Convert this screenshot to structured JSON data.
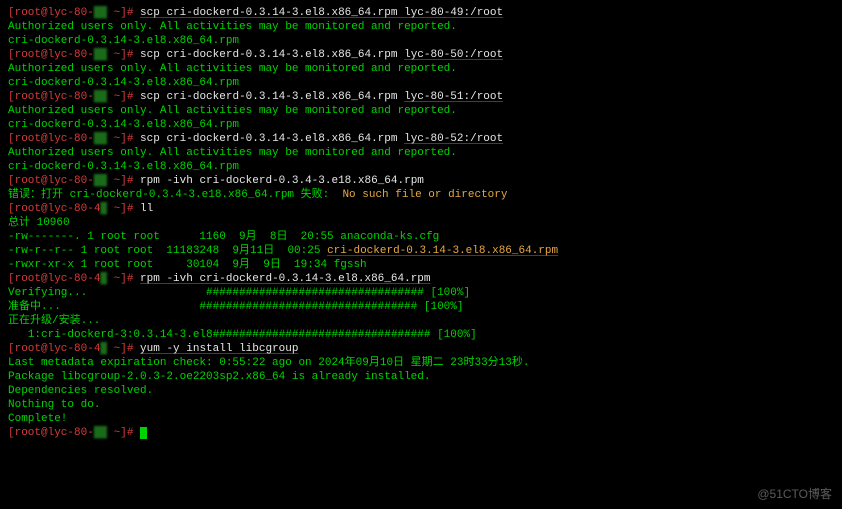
{
  "hostPartial": "lyc-80-",
  "promptSuffix": " ~]#",
  "scp": {
    "cmd": "scp cri-dockerd-0.3.14-3.el8.x86_64.rpm ",
    "targets": [
      "lyc-80-49:/root",
      "lyc-80-50:/root",
      "lyc-80-51:/root",
      "lyc-80-52:/root"
    ],
    "authMsg": "Authorized users only. All activities may be monitored and reported.",
    "fileEcho": "cri-dockerd-0.3.14-3.el8.x86_64.rpm"
  },
  "rpm1": {
    "cmd": "rpm -ivh cri-dockerd-0.3.4-3.e18.x86_64.rpm",
    "errPrefix": "错误：打开 cri-dockerd-0.3.4-3.e18.x86_64.rpm 失败:  ",
    "errMsg": "No such file or directory"
  },
  "ll": {
    "cmd": "ll",
    "total": "总计 10960",
    "rows": [
      {
        "perm": "-rw-------.",
        "n": "1",
        "u": "root",
        "g": "root",
        "size": "1160",
        "date": "9月  8日",
        "time": "20:55",
        "name": "anaconda-ks.cfg",
        "hl": false
      },
      {
        "perm": "-rw-r--r--",
        "n": "1",
        "u": "root",
        "g": "root",
        "size": "11183248",
        "date": "9月11日",
        "time": "00:25",
        "name": "cri-dockerd-0.3.14-3.el8.x86_64.rpm",
        "hl": true
      },
      {
        "perm": "-rwxr-xr-x",
        "n": "1",
        "u": "root",
        "g": "root",
        "size": "30104",
        "date": "9月  9日",
        "time": "19:34",
        "name": "fgssh",
        "hl": false
      }
    ]
  },
  "rpm2": {
    "cmd": "rpm -ivh cri-dockerd-0.3.14-3.el8.x86_64.rpm",
    "verify": "Verifying...",
    "prep": "准备中...",
    "upgrade": "正在升级/安装...",
    "pkg": "   1:cri-dockerd-3:0.3.14-3.el8",
    "bar": "################################# [100%]"
  },
  "yum": {
    "cmd": "yum -y install libcgroup",
    "meta": "Last metadata expiration check: 0:55:22 ago on 2024年09月10日 星期二 23时33分13秒.",
    "already": "Package libcgroup-2.0.3-2.oe2203sp2.x86_64 is already installed.",
    "dep": "Dependencies resolved.",
    "nothing": "Nothing to do.",
    "complete": "Complete!"
  },
  "watermark": "@51CTO博客"
}
